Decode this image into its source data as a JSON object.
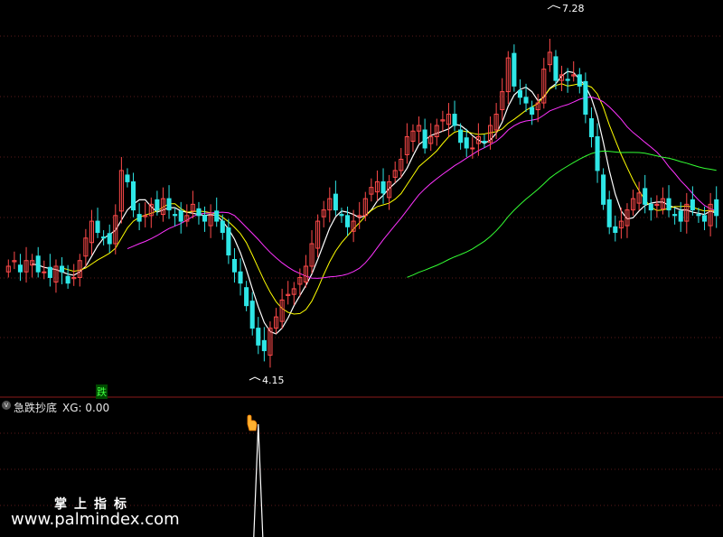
{
  "panel": {
    "indicator_name": "急跌抄底",
    "xg_label": "XG: 0.00"
  },
  "labels": {
    "high": "7.28",
    "low": "4.15",
    "signal": "跌"
  },
  "watermark": {
    "cn": "掌上指标",
    "url": "www.palmindex.com"
  },
  "colors": {
    "background": "#000000",
    "up": "#ff4a4a",
    "down": "#2ee6e6",
    "ma5": "#ffffff",
    "ma10": "#ffff00",
    "ma20": "#ff33ff",
    "ma60": "#33ff33",
    "grid": "#5a1a1a",
    "divider": "#8a1a1a",
    "signal_line": "#ffffff"
  },
  "chart_data": [
    {
      "type": "candlestick",
      "title": "",
      "ylim": [
        4.0,
        7.35
      ],
      "high_marker": 7.28,
      "low_marker": 4.15,
      "lines": [
        "ma5",
        "ma10",
        "ma20",
        "ma60"
      ],
      "closes": [
        5.05,
        5.1,
        5.0,
        5.1,
        5.1,
        5.0,
        5.0,
        4.95,
        5.05,
        5.0,
        4.9,
        4.95,
        5.1,
        5.3,
        5.45,
        5.35,
        5.3,
        5.25,
        5.5,
        5.9,
        5.8,
        5.55,
        5.45,
        5.5,
        5.6,
        5.55,
        5.65,
        5.55,
        5.5,
        5.45,
        5.5,
        5.6,
        5.5,
        5.45,
        5.5,
        5.45,
        5.35,
        5.15,
        5.0,
        4.9,
        4.7,
        4.5,
        4.35,
        4.3,
        4.5,
        4.6,
        4.75,
        4.8,
        4.85,
        4.95,
        5.05,
        5.25,
        5.45,
        5.55,
        5.65,
        5.55,
        5.5,
        5.4,
        5.45,
        5.5,
        5.65,
        5.75,
        5.8,
        5.7,
        5.8,
        5.9,
        6.0,
        6.2,
        6.25,
        6.3,
        6.1,
        6.2,
        6.3,
        6.35,
        6.4,
        6.3,
        6.15,
        6.1,
        6.1,
        6.2,
        6.15,
        6.3,
        6.4,
        6.6,
        6.9,
        6.65,
        6.55,
        6.5,
        6.4,
        6.5,
        6.8,
        6.95,
        6.7,
        6.75,
        6.7,
        6.75,
        6.65,
        6.4,
        6.2,
        5.9,
        5.6,
        5.4,
        5.35,
        5.45,
        5.55,
        5.65,
        5.7,
        5.6,
        5.55,
        5.6,
        5.65,
        5.55,
        5.5,
        5.45,
        5.6,
        5.55,
        5.5,
        5.45,
        5.6,
        5.5
      ],
      "ma60_start": 67
    },
    {
      "type": "line",
      "title": "急跌抄底",
      "series": [
        {
          "name": "XG",
          "values": [
            0,
            0,
            0,
            0,
            0,
            0,
            0,
            0,
            0,
            0,
            0,
            0,
            0,
            0,
            0,
            0,
            0,
            0,
            0,
            0,
            0,
            0,
            0,
            0,
            0,
            0,
            0,
            0,
            0,
            0,
            0,
            0,
            0,
            0,
            0,
            0,
            0,
            0,
            0,
            0,
            0,
            0,
            1,
            0,
            0,
            0,
            0,
            0,
            0,
            0,
            0,
            0,
            0,
            0,
            0,
            0,
            0,
            0,
            0,
            0,
            0,
            0,
            0,
            0,
            0,
            0,
            0,
            0,
            0,
            0,
            0,
            0,
            0,
            0,
            0,
            0,
            0,
            0,
            0,
            0,
            0,
            0,
            0,
            0,
            0,
            0,
            0,
            0,
            0,
            0,
            0,
            0,
            0,
            0,
            0,
            0,
            0,
            0,
            0,
            0,
            0,
            0,
            0,
            0,
            0,
            0,
            0,
            0,
            0,
            0,
            0,
            0,
            0,
            0,
            0,
            0,
            0,
            0,
            0,
            0,
            0
          ]
        }
      ],
      "current_value": 0.0
    }
  ]
}
